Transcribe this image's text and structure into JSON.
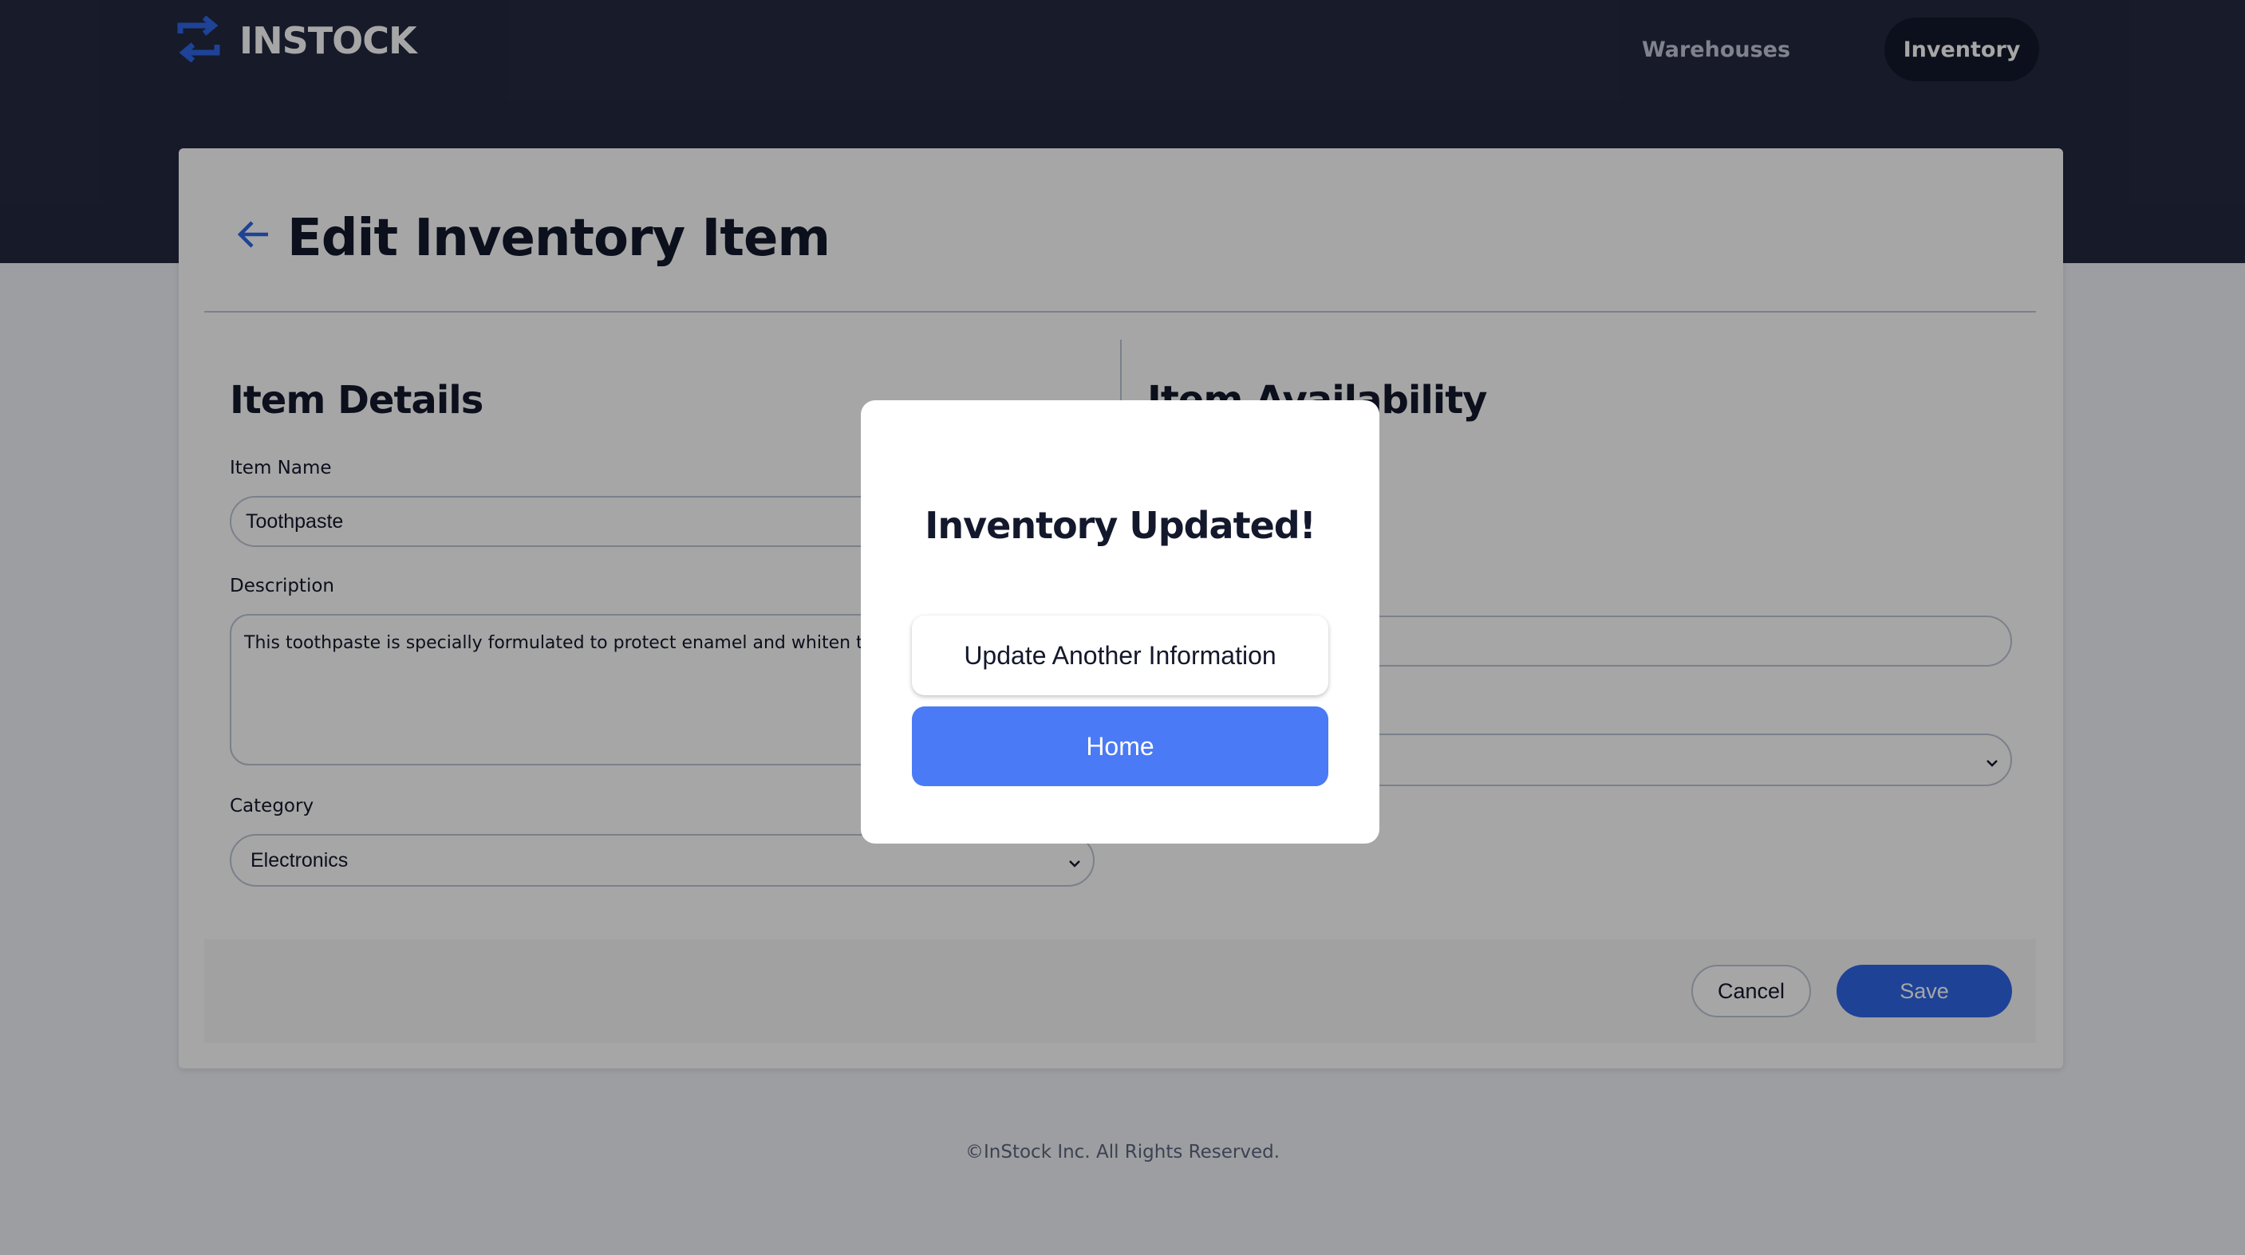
{
  "header": {
    "logo_text": "INSTOCK",
    "nav": {
      "warehouses": "Warehouses",
      "inventory": "Inventory"
    }
  },
  "page": {
    "title": "Edit Inventory Item",
    "item_details": {
      "heading": "Item Details",
      "name_label": "Item Name",
      "name_value": "Toothpaste",
      "description_label": "Description",
      "description_value": "This toothpaste is specially formulated to protect enamel and whiten teeth w",
      "category_label": "Category",
      "category_value": "Electronics"
    },
    "item_availability": {
      "heading": "Item Availability"
    },
    "actions": {
      "cancel": "Cancel",
      "save": "Save"
    }
  },
  "footer": {
    "copyright": "©InStock Inc. All Rights Reserved."
  },
  "modal": {
    "title": "Inventory Updated!",
    "secondary_button": "Update Another Information",
    "primary_button": "Home"
  },
  "colors": {
    "header_bg": "#232940",
    "accent": "#2e66e6",
    "modal_primary": "#4a7af5",
    "text": "#13182c"
  },
  "icons": {
    "logo": "swap-arrows-icon",
    "back": "arrow-left-icon",
    "select": "chevron-down-icon"
  }
}
